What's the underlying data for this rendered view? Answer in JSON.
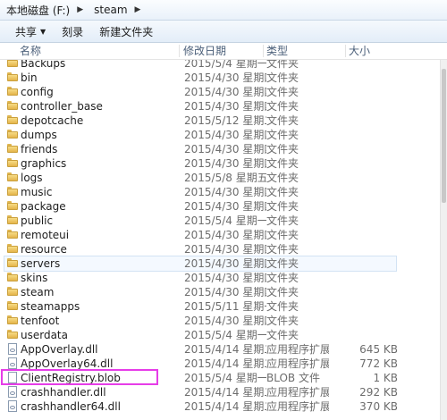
{
  "address": {
    "root": "本地磁盘 (F:)",
    "folder": "steam"
  },
  "toolbar": {
    "share": "共享",
    "burn": "刻录",
    "new_folder": "新建文件夹"
  },
  "columns": {
    "name": "名称",
    "date": "修改日期",
    "type": "类型",
    "size": "大小"
  },
  "rows": [
    {
      "name": "Backups",
      "date": "2015/5/4 星期一 ...",
      "type": "文件夹",
      "size": "",
      "icon": "folder-icon"
    },
    {
      "name": "bin",
      "date": "2015/4/30 星期四 ...",
      "type": "文件夹",
      "size": "",
      "icon": "folder-icon"
    },
    {
      "name": "config",
      "date": "2015/4/30 星期四 ...",
      "type": "文件夹",
      "size": "",
      "icon": "folder-icon"
    },
    {
      "name": "controller_base",
      "date": "2015/4/30 星期四 ...",
      "type": "文件夹",
      "size": "",
      "icon": "folder-icon"
    },
    {
      "name": "depotcache",
      "date": "2015/5/12 星期二 ...",
      "type": "文件夹",
      "size": "",
      "icon": "folder-icon"
    },
    {
      "name": "dumps",
      "date": "2015/4/30 星期四 ...",
      "type": "文件夹",
      "size": "",
      "icon": "folder-icon"
    },
    {
      "name": "friends",
      "date": "2015/4/30 星期四 ...",
      "type": "文件夹",
      "size": "",
      "icon": "folder-icon"
    },
    {
      "name": "graphics",
      "date": "2015/4/30 星期四 ...",
      "type": "文件夹",
      "size": "",
      "icon": "folder-icon"
    },
    {
      "name": "logs",
      "date": "2015/5/8 星期五 ...",
      "type": "文件夹",
      "size": "",
      "icon": "folder-icon"
    },
    {
      "name": "music",
      "date": "2015/4/30 星期四 ...",
      "type": "文件夹",
      "size": "",
      "icon": "folder-icon"
    },
    {
      "name": "package",
      "date": "2015/4/30 星期四 ...",
      "type": "文件夹",
      "size": "",
      "icon": "folder-icon"
    },
    {
      "name": "public",
      "date": "2015/5/4 星期一 ...",
      "type": "文件夹",
      "size": "",
      "icon": "folder-icon"
    },
    {
      "name": "remoteui",
      "date": "2015/4/30 星期四 ...",
      "type": "文件夹",
      "size": "",
      "icon": "folder-icon"
    },
    {
      "name": "resource",
      "date": "2015/4/30 星期四 ...",
      "type": "文件夹",
      "size": "",
      "icon": "folder-icon"
    },
    {
      "name": "servers",
      "date": "2015/4/30 星期四 ...",
      "type": "文件夹",
      "size": "",
      "icon": "folder-icon"
    },
    {
      "name": "skins",
      "date": "2015/4/30 星期四 ...",
      "type": "文件夹",
      "size": "",
      "icon": "folder-icon"
    },
    {
      "name": "steam",
      "date": "2015/4/30 星期四 ...",
      "type": "文件夹",
      "size": "",
      "icon": "folder-icon"
    },
    {
      "name": "steamapps",
      "date": "2015/5/11 星期一 ...",
      "type": "文件夹",
      "size": "",
      "icon": "folder-icon"
    },
    {
      "name": "tenfoot",
      "date": "2015/4/30 星期四 ...",
      "type": "文件夹",
      "size": "",
      "icon": "folder-icon"
    },
    {
      "name": "userdata",
      "date": "2015/5/4 星期一 ...",
      "type": "文件夹",
      "size": "",
      "icon": "folder-icon"
    },
    {
      "name": "AppOverlay.dll",
      "date": "2015/4/14 星期二 ...",
      "type": "应用程序扩展",
      "size": "645 KB",
      "icon": "dll-file-icon"
    },
    {
      "name": "AppOverlay64.dll",
      "date": "2015/4/14 星期二 ...",
      "type": "应用程序扩展",
      "size": "772 KB",
      "icon": "dll-file-icon"
    },
    {
      "name": "ClientRegistry.blob",
      "date": "2015/5/4 星期一 ...",
      "type": "BLOB 文件",
      "size": "1 KB",
      "icon": "blob-file-icon"
    },
    {
      "name": "crashhandler.dll",
      "date": "2015/4/14 星期二 ...",
      "type": "应用程序扩展",
      "size": "292 KB",
      "icon": "dll-file-icon"
    },
    {
      "name": "crashhandler64.dll",
      "date": "2015/4/14 星期二 ...",
      "type": "应用程序扩展",
      "size": "370 KB",
      "icon": "dll-file-icon"
    }
  ],
  "highlight_row": "servers",
  "outlined_row": "ClientRegistry.blob"
}
